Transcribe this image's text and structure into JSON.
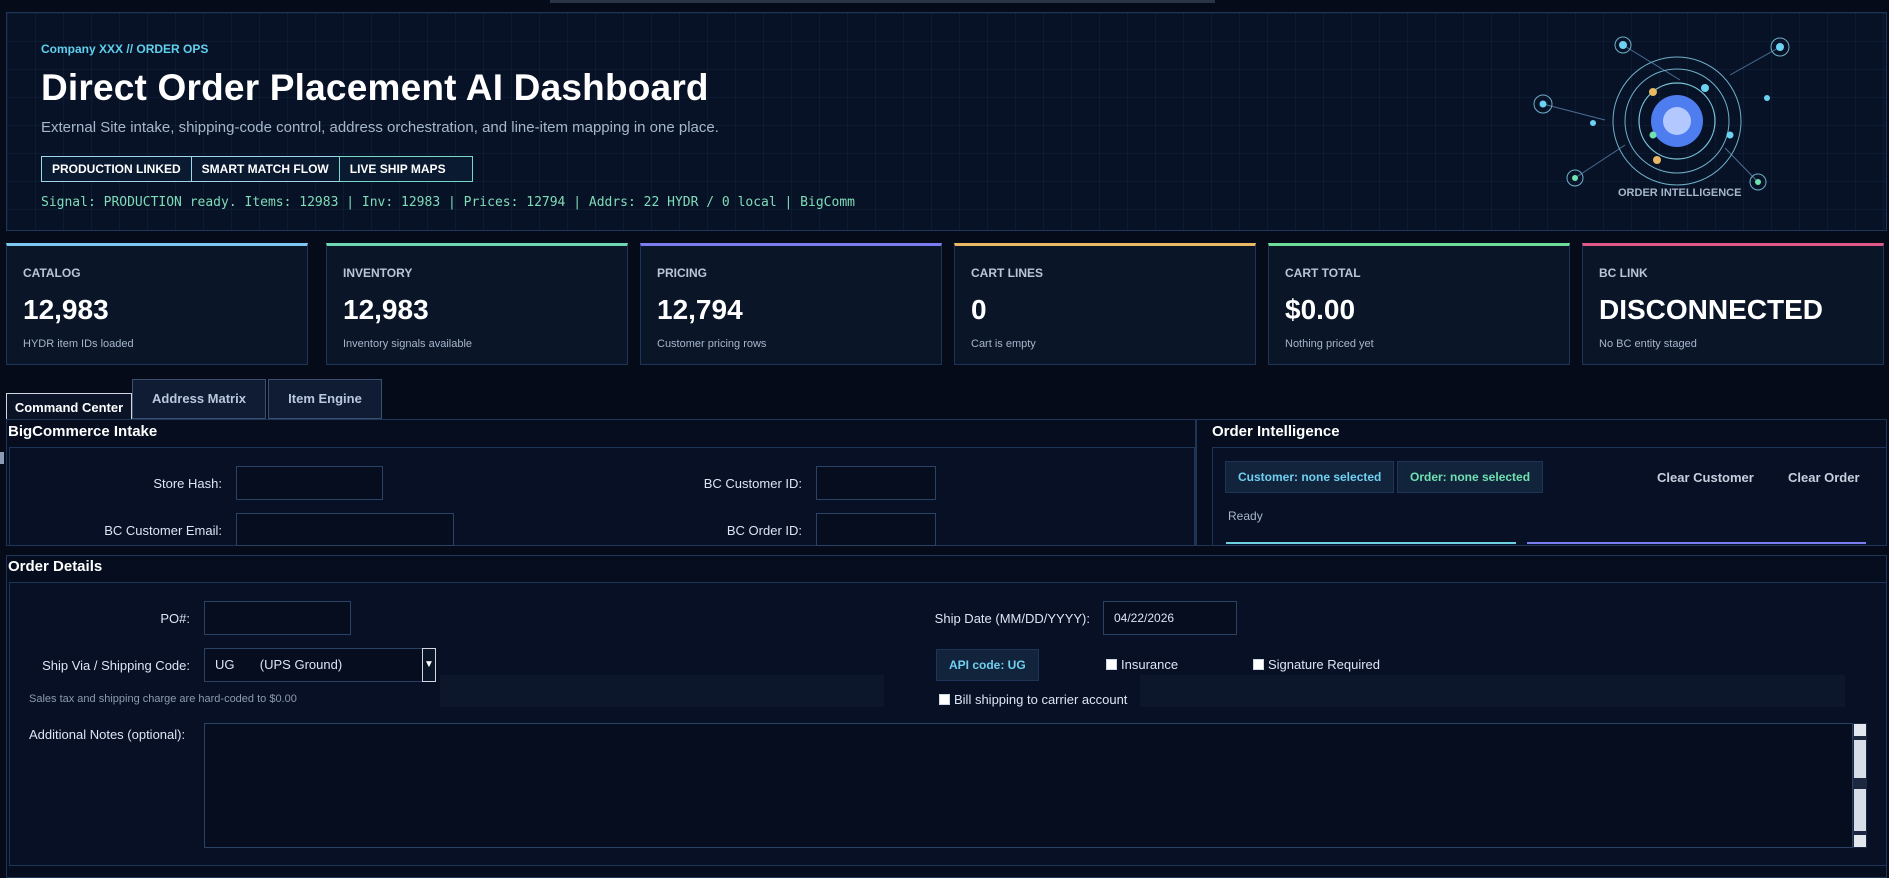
{
  "header": {
    "breadcrumb": "Company XXX // ORDER OPS",
    "title": "Direct Order Placement AI Dashboard",
    "subtitle": "External Site intake, shipping-code control, address orchestration, and line-item mapping in one place.",
    "chips": [
      "PRODUCTION LINKED",
      "SMART MATCH FLOW",
      "LIVE SHIP MAPS"
    ],
    "signal": "Signal: PRODUCTION ready. Items: 12983 | Inv: 12983 | Prices: 12794 | Addrs: 22 HYDR / 0 local | BigComm",
    "orb_label": "ORDER INTELLIGENCE"
  },
  "cards": [
    {
      "label": "CATALOG",
      "value": "12,983",
      "sub": "HYDR item IDs loaded",
      "color": "#7cc7ef"
    },
    {
      "label": "INVENTORY",
      "value": "12,983",
      "sub": "Inventory signals available",
      "color": "#6fd6b4"
    },
    {
      "label": "PRICING",
      "value": "12,794",
      "sub": "Customer pricing rows",
      "color": "#7b7cf0"
    },
    {
      "label": "CART LINES",
      "value": "0",
      "sub": "Cart is empty",
      "color": "#e8b862"
    },
    {
      "label": "CART TOTAL",
      "value": "$0.00",
      "sub": "Nothing priced yet",
      "color": "#6fdd9a"
    },
    {
      "label": "BC LINK",
      "value": "DISCONNECTED",
      "sub": "No BC entity staged",
      "color": "#e0578a"
    }
  ],
  "tabs": [
    "Command Center",
    "Address Matrix",
    "Item Engine"
  ],
  "intake": {
    "title": "BigCommerce Intake",
    "store_hash_label": "Store Hash:",
    "store_hash_value": "",
    "customer_id_label": "BC Customer ID:",
    "customer_id_value": "",
    "customer_email_label": "BC Customer Email:",
    "customer_email_value": "",
    "order_id_label": "BC Order ID:",
    "order_id_value": ""
  },
  "intelligence": {
    "title": "Order Intelligence",
    "customer_pill": "Customer: none selected",
    "order_pill": "Order: none selected",
    "clear_customer": "Clear Customer",
    "clear_order": "Clear Order",
    "status": "Ready",
    "customer_pill_color": "#6fd0f0",
    "order_pill_color": "#6fe0b0"
  },
  "order": {
    "title": "Order Details",
    "po_label": "PO#:",
    "po_value": "",
    "ship_date_label": "Ship Date (MM/DD/YYYY):",
    "ship_date_value": "04/22/2026",
    "ship_via_label": "Ship Via / Shipping Code:",
    "ship_via_value": "UG       (UPS Ground)",
    "api_code": "API code: UG",
    "insurance_label": "Insurance",
    "signature_label": "Signature Required",
    "bill_carrier_label": "Bill shipping to carrier account",
    "tax_note": "Sales tax and shipping charge are hard-coded to $0.00",
    "notes_label": "Additional Notes (optional):",
    "notes_value": ""
  }
}
